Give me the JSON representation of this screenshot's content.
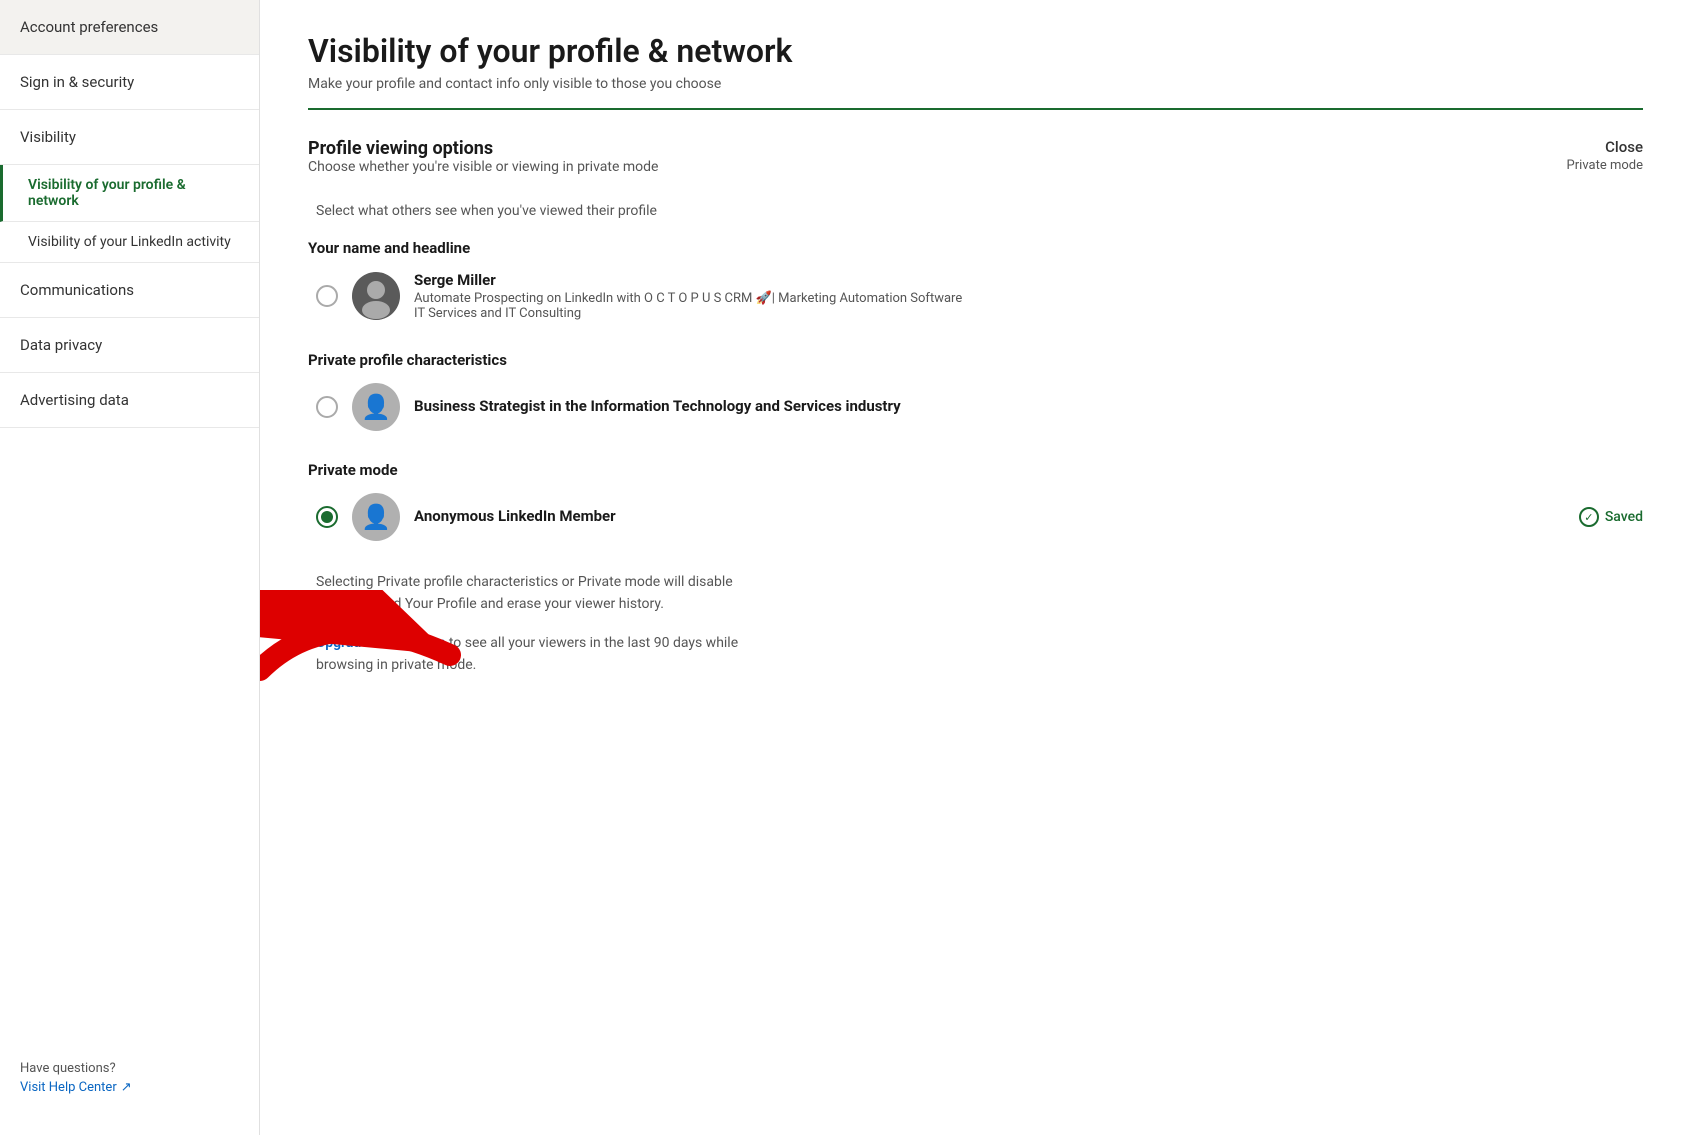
{
  "sidebar": {
    "items": [
      {
        "id": "account-preferences",
        "label": "Account preferences",
        "active": false,
        "level": "top"
      },
      {
        "id": "sign-in-security",
        "label": "Sign in & security",
        "active": false,
        "level": "top"
      },
      {
        "id": "visibility",
        "label": "Visibility",
        "active": false,
        "level": "top"
      },
      {
        "id": "visibility-profile-network",
        "label": "Visibility of your profile & network",
        "active": true,
        "level": "sub"
      },
      {
        "id": "visibility-linkedin-activity",
        "label": "Visibility of your LinkedIn activity",
        "active": false,
        "level": "sub"
      },
      {
        "id": "communications",
        "label": "Communications",
        "active": false,
        "level": "top"
      },
      {
        "id": "data-privacy",
        "label": "Data privacy",
        "active": false,
        "level": "top"
      },
      {
        "id": "advertising-data",
        "label": "Advertising data",
        "active": false,
        "level": "top"
      }
    ],
    "footer": {
      "have_questions": "Have questions?",
      "help_link": "Visit Help Center",
      "help_icon": "external-link-icon"
    }
  },
  "main": {
    "page_title": "Visibility of your profile & network",
    "page_subtitle": "Make your profile and contact info only visible to those you choose",
    "section_title": "Profile viewing options",
    "section_desc": "Choose whether you're visible or viewing in private mode",
    "close_label": "Close",
    "close_subtitle": "Private mode",
    "select_label": "Select what others see when you've viewed their profile",
    "option_groups": [
      {
        "id": "your-name-headline",
        "title": "Your name and headline",
        "options": [
          {
            "id": "name-headline-option",
            "selected": false,
            "avatar_type": "photo",
            "name": "Serge Miller",
            "description": "Automate Prospecting on LinkedIn with O C T O P U S CRM 🚀| Marketing Automation Software\nIT Services and IT Consulting"
          }
        ]
      },
      {
        "id": "private-profile-characteristics",
        "title": "Private profile characteristics",
        "options": [
          {
            "id": "private-characteristics-option",
            "selected": false,
            "avatar_type": "generic",
            "name": "Business Strategist in the Information Technology and Services industry",
            "description": ""
          }
        ]
      },
      {
        "id": "private-mode",
        "title": "Private mode",
        "options": [
          {
            "id": "private-mode-option",
            "selected": true,
            "avatar_type": "generic",
            "name": "Anonymous LinkedIn Member",
            "description": "",
            "saved": true,
            "saved_label": "Saved"
          }
        ]
      }
    ],
    "footer_note": "Selecting Private profile characteristics or Private mode will disable\nWho's Viewed Your Profile and erase your viewer history.",
    "upgrade_text_prefix": "",
    "upgrade_link_text": "Upgrade to Premium",
    "upgrade_text_suffix": " to see all your viewers in the last 90 days while\nbrowsing in private mode."
  }
}
